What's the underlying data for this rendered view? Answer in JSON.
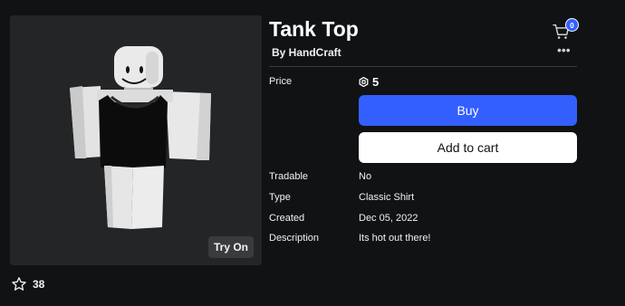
{
  "item": {
    "title": "Tank Top",
    "creator": "By HandCraft"
  },
  "preview": {
    "try_on_label": "Try On"
  },
  "favorites": {
    "icon": "star-outline-icon",
    "count": "38"
  },
  "header": {
    "cart_icon": "shopping-cart-icon",
    "cart_count": "0",
    "more_icon": "more-horizontal-icon",
    "more_glyph": "•••"
  },
  "details": {
    "price_label": "Price",
    "price_icon": "robux-icon",
    "price_value": "5",
    "buy_label": "Buy",
    "add_to_cart_label": "Add to cart",
    "tradable_label": "Tradable",
    "tradable_value": "No",
    "type_label": "Type",
    "type_value": "Classic Shirt",
    "created_label": "Created",
    "created_value": "Dec 05, 2022",
    "description_label": "Description",
    "description_value": "Its hot out there!"
  },
  "colors": {
    "background": "#111214",
    "panel": "#232527",
    "primary_button": "#335fff",
    "secondary_button": "#ffffff"
  }
}
